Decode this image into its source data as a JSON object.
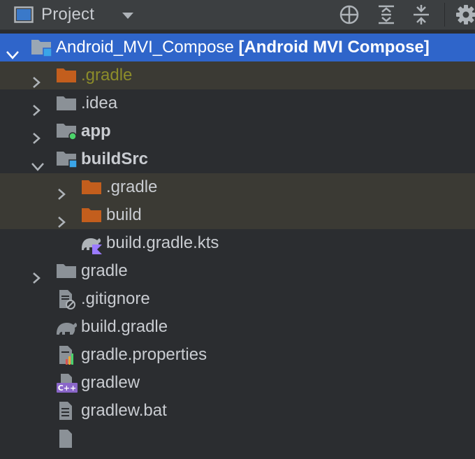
{
  "panel": {
    "title": "Project",
    "toolbar": {
      "locate_icon": "crosshair-icon",
      "expand_all_icon": "expand-all-icon",
      "collapse_all_icon": "collapse-all-icon",
      "settings_icon": "gear-icon"
    }
  },
  "colors": {
    "background": "#2b2d30",
    "selection": "#2f65ca",
    "excluded_row": "#3b3a34",
    "folder_grey": "#8b9197",
    "folder_orange": "#c35e1d",
    "module_dot_green": "#4bd36a",
    "module_dot_blue": "#3aa5e8",
    "excluded_text": "#8c8c2a"
  },
  "tree": {
    "root": {
      "name": "Android_MVI_Compose",
      "module": "[Android MVI Compose]"
    },
    "items": [
      {
        "label": ".gradle",
        "icon": "folder-excluded-icon"
      },
      {
        "label": ".idea",
        "icon": "folder-icon"
      },
      {
        "label": "app",
        "icon": "module-folder-icon"
      },
      {
        "label": "buildSrc",
        "icon": "source-module-folder-icon"
      },
      {
        "label": ".gradle",
        "icon": "folder-excluded-icon"
      },
      {
        "label": "build",
        "icon": "folder-excluded-icon"
      },
      {
        "label": "build.gradle.kts",
        "icon": "gradle-kotlin-file-icon"
      },
      {
        "label": "gradle",
        "icon": "folder-icon"
      },
      {
        "label": ".gitignore",
        "icon": "ignore-file-icon"
      },
      {
        "label": "build.gradle",
        "icon": "gradle-file-icon"
      },
      {
        "label": "gradle.properties",
        "icon": "properties-file-icon"
      },
      {
        "label": "gradlew",
        "icon": "shell-script-file-icon"
      },
      {
        "label": "gradlew.bat",
        "icon": "text-file-icon"
      }
    ]
  }
}
